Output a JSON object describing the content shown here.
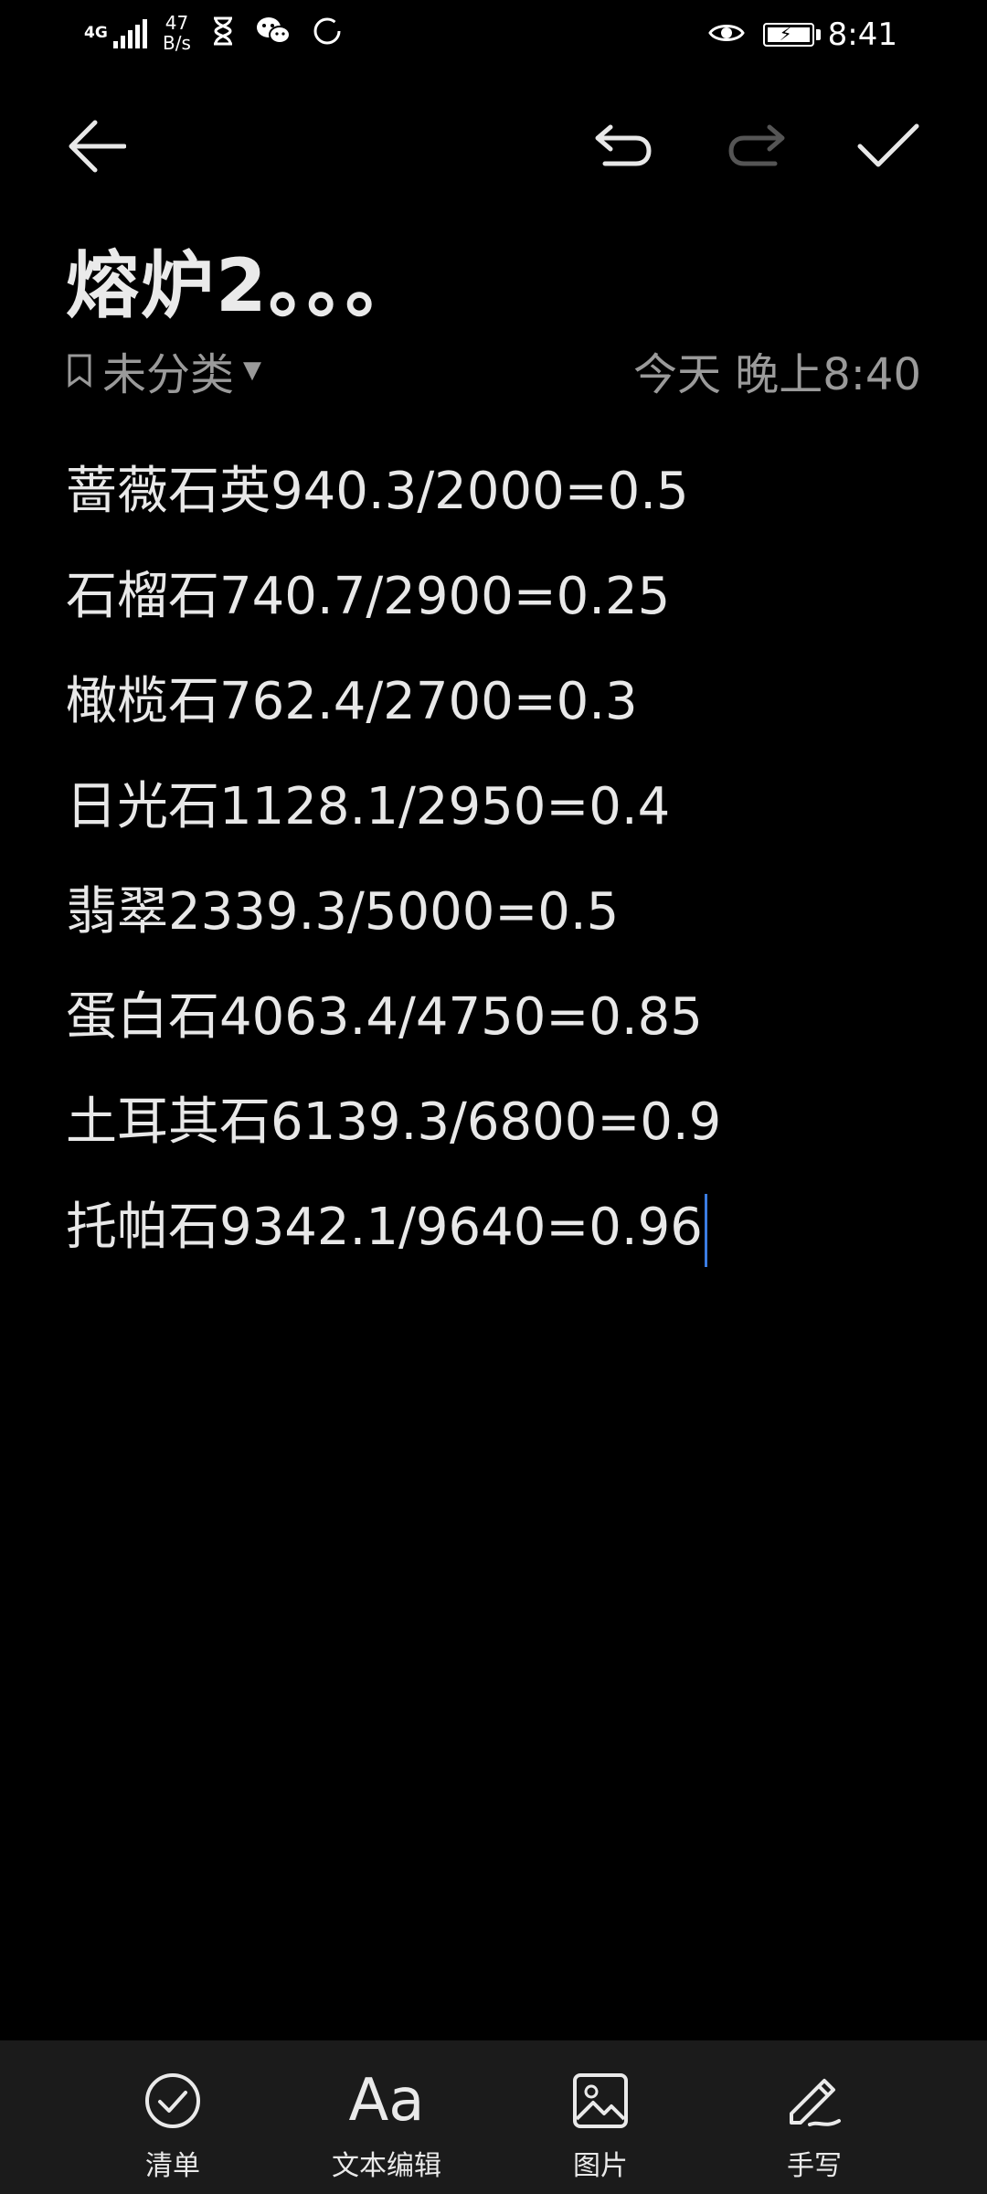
{
  "status_bar": {
    "network": "4G",
    "speed_value": "47",
    "speed_unit": "B/s",
    "time": "8:41"
  },
  "note": {
    "title": "熔炉2。。。",
    "category": "未分类",
    "timestamp": "今天 晚上8:40",
    "lines": [
      "蔷薇石英940.3/2000=0.5",
      "石榴石740.7/2900=0.25",
      "橄榄石762.4/2700=0.3",
      "日光石1128.1/2950=0.4",
      "翡翠2339.3/5000=0.5",
      "蛋白石4063.4/4750=0.85",
      "土耳其石6139.3/6800=0.9",
      "托帕石9342.1/9640=0.96"
    ]
  },
  "bottom_bar": {
    "checklist": "清单",
    "text_edit": "文本编辑",
    "text_edit_icon": "Aa",
    "image": "图片",
    "handwrite": "手写"
  },
  "colors": {
    "background": "#000000",
    "text": "#e8e8e8",
    "muted": "#9a9a9a",
    "cursor": "#3b7de3",
    "bottom_bar": "#1b1b1b"
  }
}
